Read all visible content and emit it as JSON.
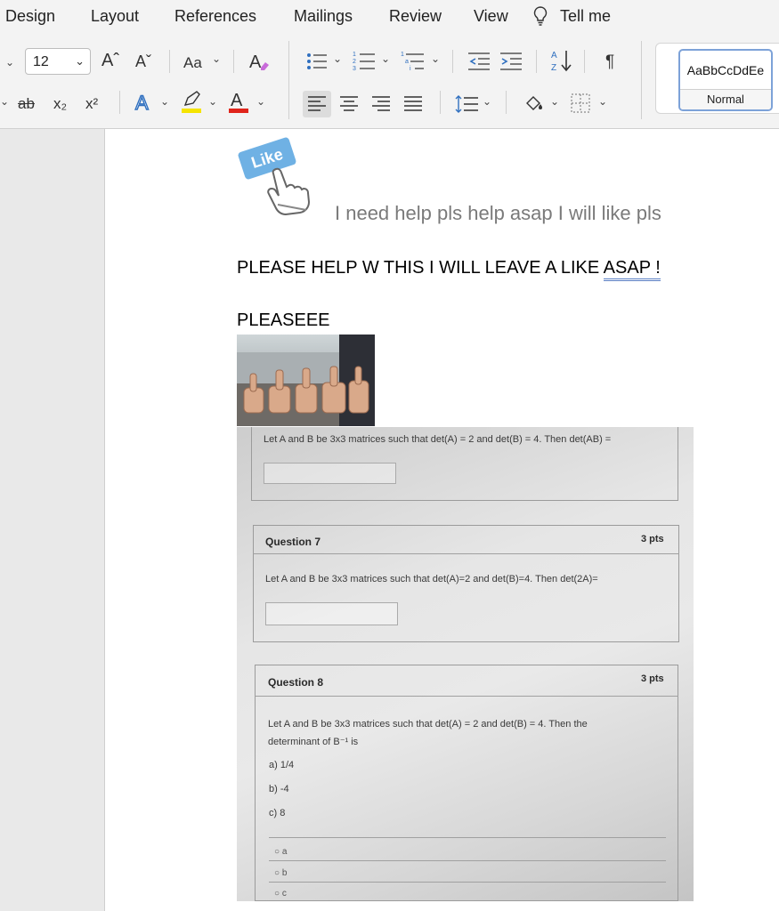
{
  "menu_tabs": [
    "Design",
    "Layout",
    "References",
    "Mailings",
    "Review",
    "View",
    "Tell me"
  ],
  "ribbon": {
    "font_size": "12",
    "grow_font": "Aˆ",
    "shrink_font": "Aˇ",
    "change_case": "Aa",
    "strike": "ab",
    "subscript": "x₂",
    "superscript": "x²",
    "style_sample": "AaBbCcDdEe",
    "style_name": "Normal",
    "highlight_color": "#f5e400",
    "font_color": "#e0241b"
  },
  "document": {
    "caption": "I need help pls help asap I will like pls",
    "like_label": "Like",
    "line1": "PLEASE HELP W THIS I WILL LEAVE A LIKE",
    "line1_asap": "ASAP !",
    "line2": "PLEASEEE"
  },
  "screenshot": {
    "q6_text": "Let A and B be 3x3 matrices such that det(A) = 2 and det(B) = 4.  Then det(AB) =",
    "q7_title": "Question 7",
    "q7_pts": "3 pts",
    "q7_text": "Let A and B be 3x3 matrices such that det(A)=2 and det(B)=4.  Then det(2A)=",
    "q8_title": "Question 8",
    "q8_pts": "3 pts",
    "q8_text1": "Let A and B be 3x3 matrices such that det(A) = 2 and det(B) = 4.  Then the",
    "q8_text2": "determinant of B⁻¹ is",
    "options": [
      "a) 1/4",
      "b) -4",
      "c) 8"
    ],
    "radios": [
      "a",
      "b",
      "c"
    ]
  }
}
